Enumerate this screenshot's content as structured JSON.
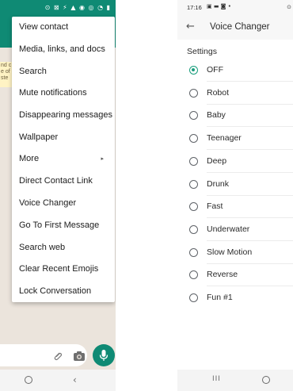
{
  "left_screen": {
    "status_icons": "⊙ ⊠ ⚡ ▲ ◉ ◎ ◔ ▮",
    "system_message_fragment": "nd c\ne of\nste",
    "menu": {
      "items": [
        "View contact",
        "Media, links, and docs",
        "Search",
        "Mute notifications",
        "Disappearing messages",
        "Wallpaper",
        "More",
        "Direct Contact Link",
        "Voice Changer",
        "Go To First Message",
        "Search web",
        "Clear Recent Emojis",
        "Lock Conversation"
      ],
      "more_arrow": "▸"
    },
    "nav_back": "‹"
  },
  "right_screen": {
    "status_time": "17:16",
    "status_icons": "▣ ▬ ◙ •",
    "status_right": "⊙",
    "back_arrow": "←",
    "title": "Voice Changer",
    "section": "Settings",
    "selected": "OFF",
    "options": [
      "OFF",
      "Robot",
      "Baby",
      "Teenager",
      "Deep",
      "Drunk",
      "Fast",
      "Underwater",
      "Slow Motion",
      "Reverse",
      "Fun #1"
    ],
    "nav_recents": "III"
  },
  "colors": {
    "whatsapp_green": "#0f8a74",
    "radio_selected": "#1a9e7d"
  }
}
